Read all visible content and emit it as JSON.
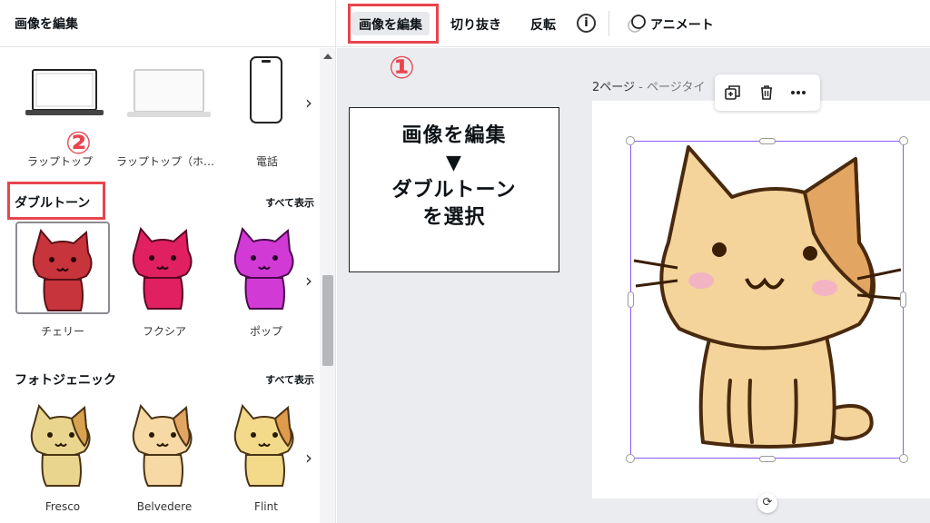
{
  "panel": {
    "title": "画像を編集",
    "devices": [
      {
        "label": "ラップトップ"
      },
      {
        "label": "ラップトップ（ホ…"
      },
      {
        "label": "電話"
      }
    ],
    "duotone": {
      "title": "ダブルトーン",
      "see_all": "すべて表示",
      "items": [
        {
          "label": "チェリー",
          "color": "#c8343c"
        },
        {
          "label": "フクシア",
          "color": "#e02060"
        },
        {
          "label": "ポップ",
          "color": "#d23ad6"
        }
      ]
    },
    "photogenic": {
      "title": "フォトジェニック",
      "see_all": "すべて表示",
      "items": [
        {
          "label": "Fresco"
        },
        {
          "label": "Belvedere"
        },
        {
          "label": "Flint"
        }
      ]
    }
  },
  "toolbar": {
    "edit_image": "画像を編集",
    "crop": "切り抜き",
    "flip": "反転",
    "info": "i",
    "animate": "アニメート"
  },
  "canvas": {
    "page_label": "2ページ",
    "page_title_partial": " - ページタイ"
  },
  "annotations": {
    "step1": "①",
    "step2": "②",
    "callout_line1": "画像を編集",
    "callout_arrow": "▼",
    "callout_line2": "ダブルトーン",
    "callout_line3": "を選択"
  },
  "colors": {
    "annotation_red": "#e8454f",
    "selection_purple": "#8b5cf6"
  }
}
